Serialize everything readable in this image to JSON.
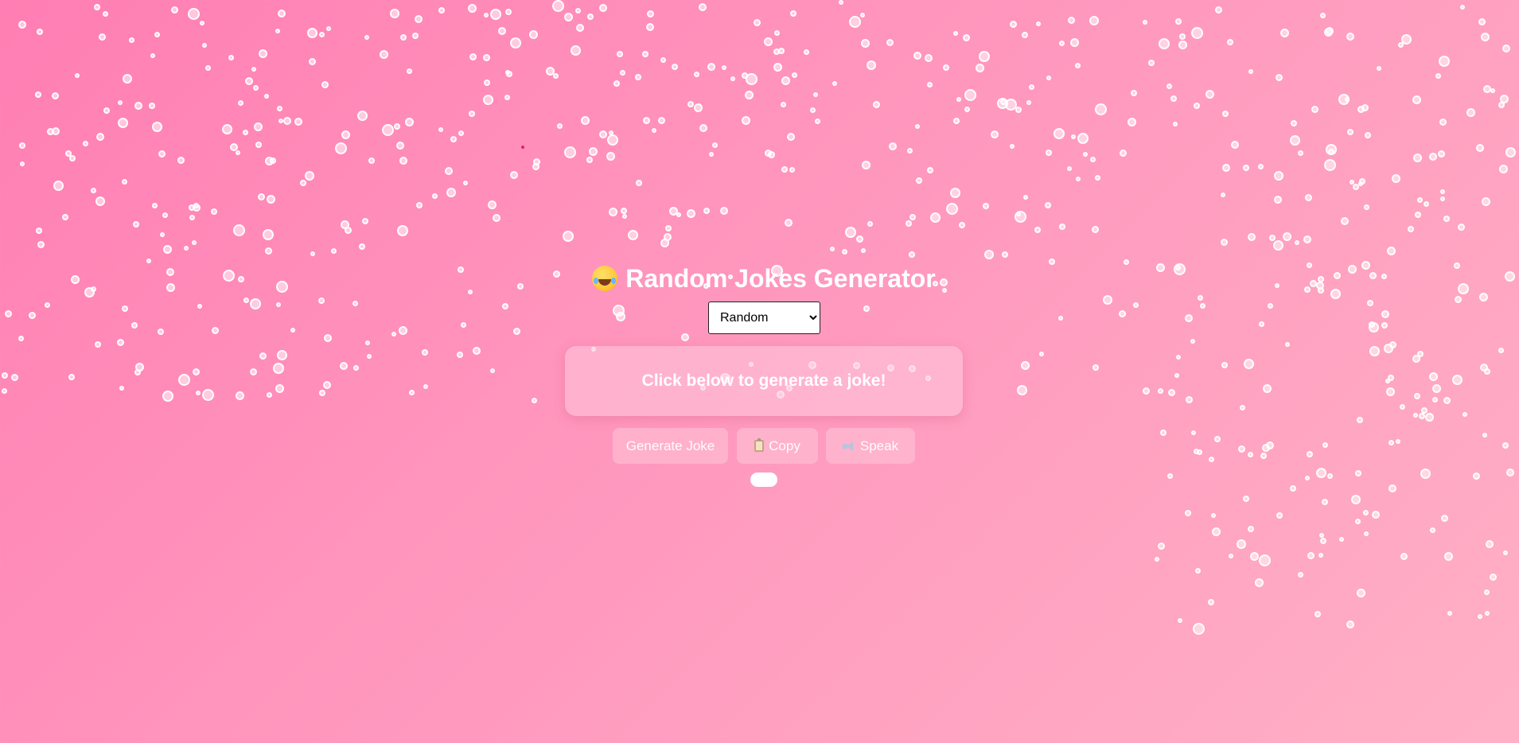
{
  "app": {
    "title": "Random Jokes Generator",
    "title_emoji": "laughing-face-with-tears-icon"
  },
  "category_select": {
    "selected": "Random",
    "options": [
      "Random"
    ]
  },
  "joke_card": {
    "text": "Click below to generate a joke!"
  },
  "buttons": {
    "generate_label": "Generate Joke",
    "copy_label": "Copy",
    "copy_icon": "clipboard-icon",
    "speak_label": "Speak",
    "speak_icon": "speaker-icon"
  },
  "colors": {
    "background_start": "#ff7eb3",
    "background_end": "#ffb0c6",
    "text": "#ffffff"
  }
}
